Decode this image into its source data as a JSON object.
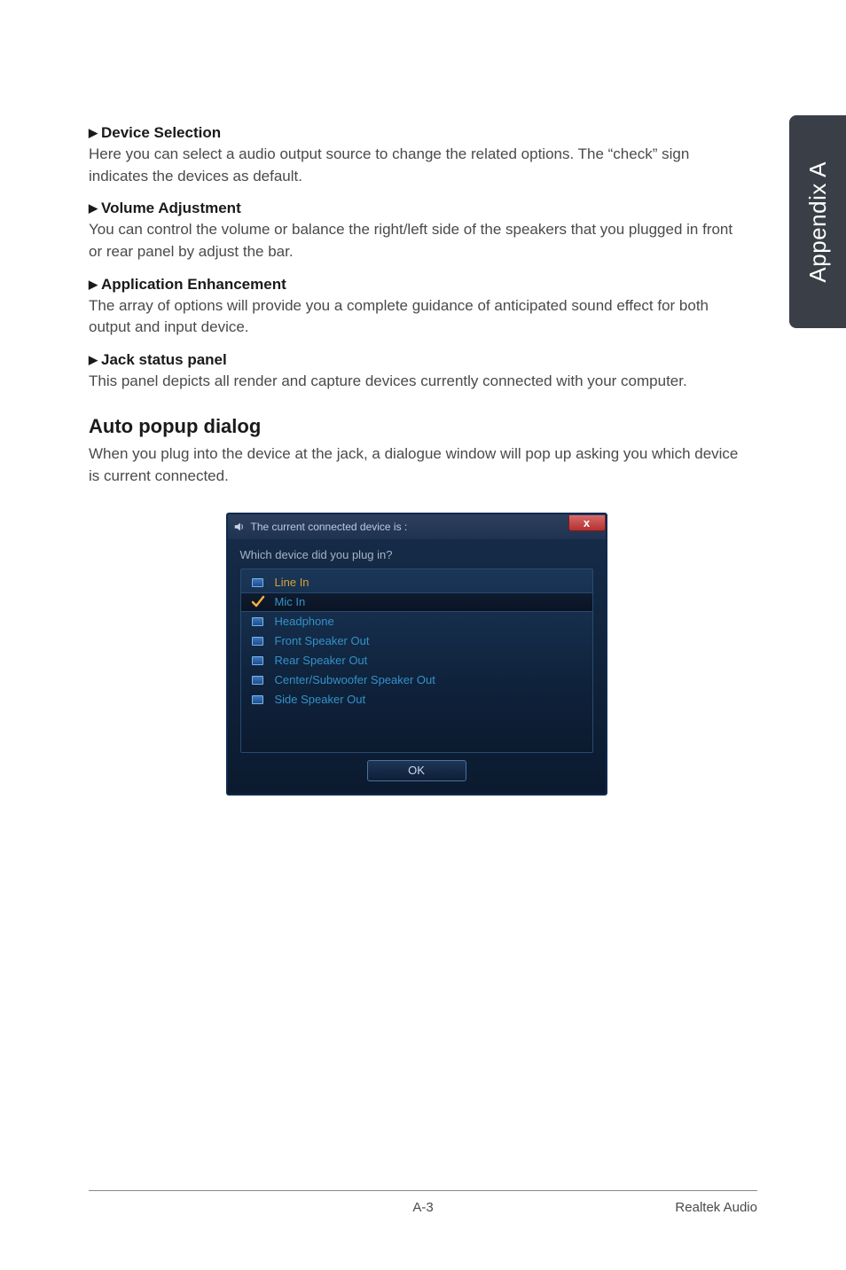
{
  "side_tab": {
    "label": "Appendix A"
  },
  "sections": {
    "device_selection": {
      "title": "Device Selection",
      "body": "Here you can select a audio output source to change the related options. The “check” sign indicates the devices as default."
    },
    "volume_adjustment": {
      "title": "Volume Adjustment",
      "body": "You can control the volume or balance the right/left side of the speakers that you plugged in front or rear panel by adjust the bar."
    },
    "application_enhancement": {
      "title": "Application Enhancement",
      "body": "The array of options will provide you a complete guidance of anticipated sound effect for both output and input device."
    },
    "jack_status": {
      "title": "Jack status panel",
      "body": "This panel depicts all render and capture devices currently connected with your computer."
    }
  },
  "auto_popup": {
    "heading": "Auto popup dialog",
    "body": "When you plug into the device at the jack, a dialogue window will pop up asking you which device is current connected."
  },
  "dialog": {
    "title": "The current connected device is :",
    "prompt": "Which device did you plug in?",
    "close_label": "x",
    "ok_label": "OK",
    "devices": [
      {
        "label": "Line In",
        "checked": false,
        "highlight": "line-in"
      },
      {
        "label": "Mic In",
        "checked": true,
        "selected": true
      },
      {
        "label": "Headphone",
        "checked": false
      },
      {
        "label": "Front Speaker Out",
        "checked": false
      },
      {
        "label": "Rear Speaker Out",
        "checked": false
      },
      {
        "label": "Center/Subwoofer Speaker Out",
        "checked": false
      },
      {
        "label": "Side Speaker Out",
        "checked": false
      }
    ]
  },
  "footer": {
    "page_num": "A-3",
    "right": "Realtek Audio"
  }
}
